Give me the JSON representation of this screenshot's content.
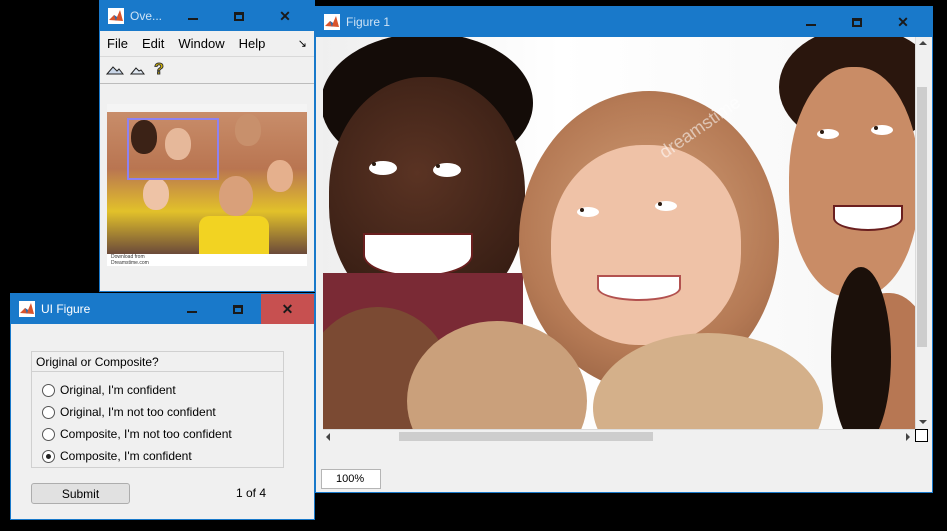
{
  "overview_window": {
    "title": "Ove...",
    "menu": [
      "File",
      "Edit",
      "Window",
      "Help"
    ],
    "menu_overflow": "↘",
    "tools": [
      "zoom-in-icon",
      "zoom-out-icon",
      "help-icon"
    ],
    "help_glyph": "?",
    "watermark_line1": "Download from",
    "watermark_line2": "Dreamstime.com"
  },
  "figure_window": {
    "title": "Figure 1",
    "watermark": "dreamstime",
    "zoom_level": "100%"
  },
  "ui_figure": {
    "title": "UI Figure",
    "group_title": "Original or Composite?",
    "options": [
      {
        "label": "Original, I'm confident",
        "selected": false
      },
      {
        "label": "Original, I'm not too confident",
        "selected": false
      },
      {
        "label": "Composite, I'm not too confident",
        "selected": false
      },
      {
        "label": "Composite, I'm confident",
        "selected": true
      }
    ],
    "submit_label": "Submit",
    "counter": "1 of 4"
  },
  "colors": {
    "titlebar": "#1979ca",
    "close_hover": "#c75050"
  }
}
